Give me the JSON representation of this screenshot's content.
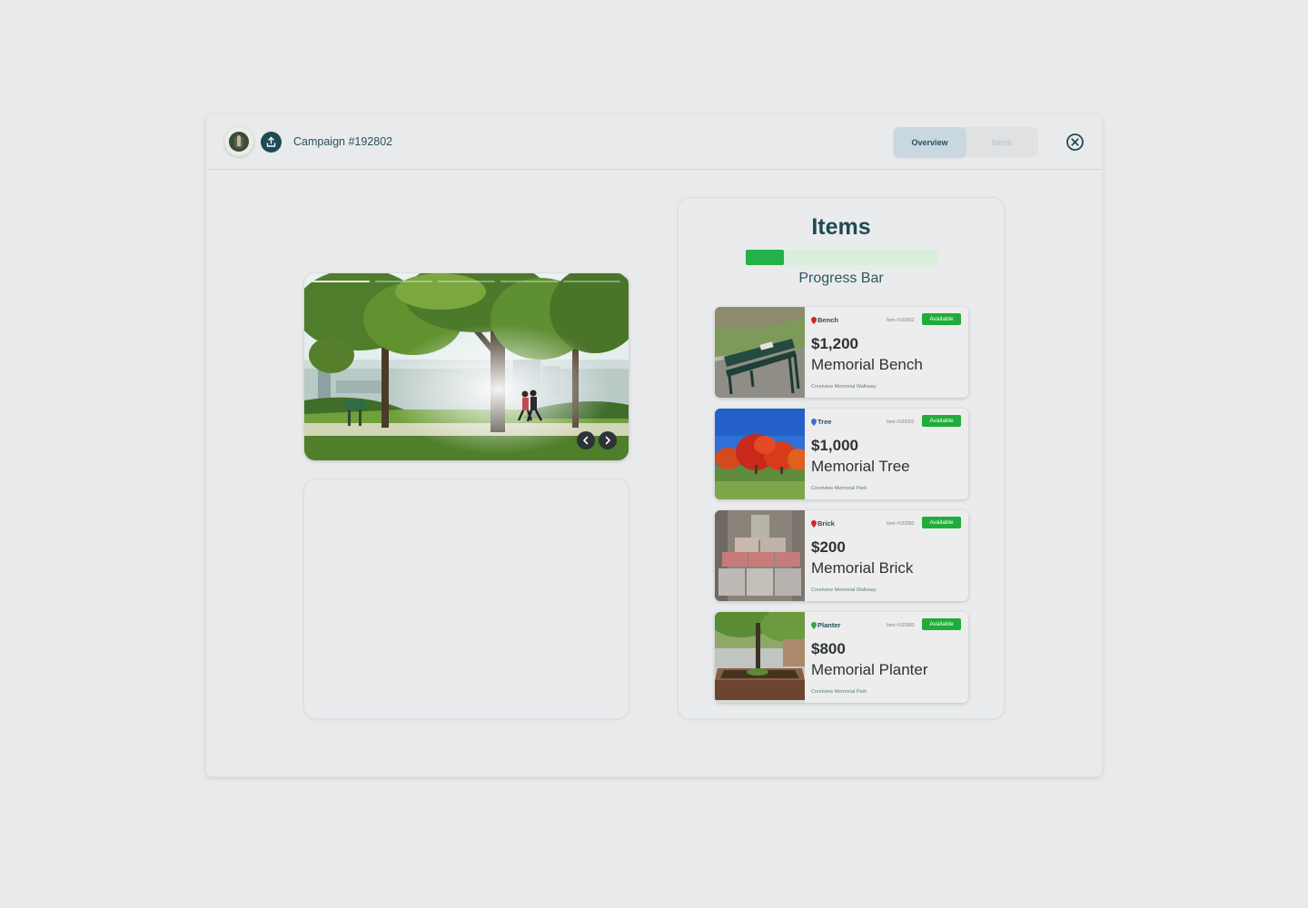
{
  "header": {
    "campaign_title": "Campaign #192802",
    "tabs": [
      {
        "label": "Overview",
        "active": true
      },
      {
        "label": "Items",
        "active": false
      }
    ]
  },
  "gallery": {
    "slide_count": 5,
    "active_slide": 1
  },
  "items_panel": {
    "heading": "Items",
    "progress_label": "Progress Bar",
    "progress_fraction": 0.2,
    "items": [
      {
        "type": "Bench",
        "item_id": "Item #192802",
        "status": "Available",
        "price": "$1,200",
        "name": "Memorial Bench",
        "location": "Crestview Memorial Walkway",
        "pin_color": "#d0262b"
      },
      {
        "type": "Tree",
        "item_id": "Item #192002",
        "status": "Available",
        "price": "$1,000",
        "name": "Memorial Tree",
        "location": "Crestview Memorial Park",
        "pin_color": "#3a6fd1"
      },
      {
        "type": "Brick",
        "item_id": "Item #192982",
        "status": "Available",
        "price": "$200",
        "name": "Memorial Brick",
        "location": "Crestview Memorial Walkway",
        "pin_color": "#d0262b"
      },
      {
        "type": "Planter",
        "item_id": "Item #192983",
        "status": "Available",
        "price": "$800",
        "name": "Memorial Planter",
        "location": "Crestview Memorial Park",
        "pin_color": "#2fa84a"
      }
    ]
  },
  "colors": {
    "brand_dark": "#1f4a55",
    "available_green": "#1fac3a",
    "progress_green": "#25b14a"
  }
}
